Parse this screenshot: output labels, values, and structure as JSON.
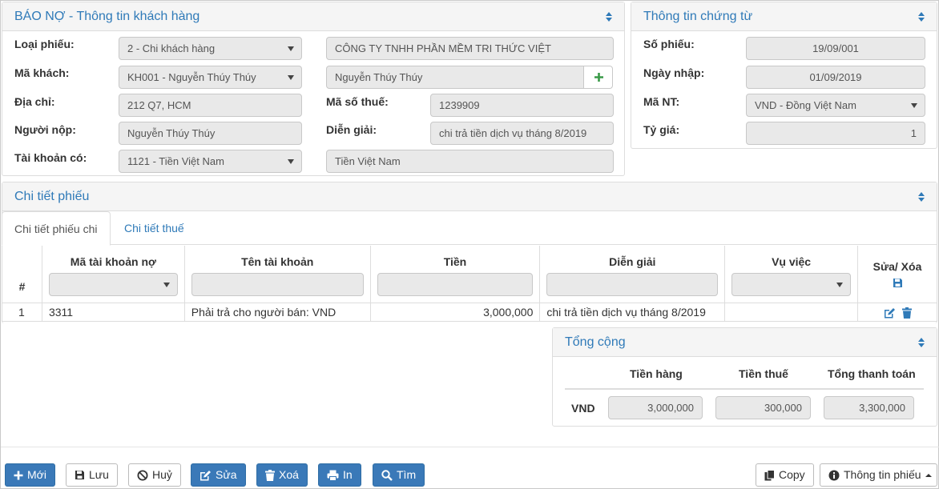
{
  "customer_panel": {
    "title": "BÁO NỢ - Thông tin khách hàng",
    "labels": {
      "voucher_type": "Loại phiếu:",
      "customer_code": "Mã khách:",
      "address": "Địa chỉ:",
      "payer": "Người nộp:",
      "credit_account": "Tài khoản có:",
      "tax_code": "Mã số thuế:",
      "description": "Diễn giải:"
    },
    "values": {
      "voucher_type": "2 - Chi khách hàng",
      "company": "CÔNG TY TNHH PHẦN MỀM TRI THỨC VIỆT",
      "customer_code": "KH001 - Nguyễn Thúy Thúy",
      "customer_name": "Nguyễn Thúy Thúy",
      "address": "212 Q7, HCM",
      "tax_code": "1239909",
      "payer": "Nguyễn Thúy Thúy",
      "description": "chi trả tiền dịch vụ tháng 8/2019",
      "credit_account": "1121 - Tiền Việt Nam",
      "credit_account_name": "Tiền Việt Nam"
    }
  },
  "document_panel": {
    "title": "Thông tin chứng từ",
    "labels": {
      "voucher_no": "Số phiếu:",
      "entry_date": "Ngày nhập:",
      "currency": "Mã NT:",
      "exchange_rate": "Tỷ giá:"
    },
    "values": {
      "voucher_no": "19/09/001",
      "entry_date": "01/09/2019",
      "currency": "VND - Đồng Việt Nam",
      "exchange_rate": "1"
    }
  },
  "detail_panel": {
    "title": "Chi tiết phiếu",
    "tabs": [
      "Chi tiết phiếu chi",
      "Chi tiết thuế"
    ],
    "columns": {
      "index": "#",
      "debit_account": "Mã tài khoản nợ",
      "account_name": "Tên tài khoản",
      "amount": "Tiền",
      "description": "Diễn giải",
      "case": "Vụ việc",
      "actions": "Sửa/ Xóa"
    },
    "rows": [
      {
        "index": "1",
        "debit_account": "3311",
        "account_name": "Phải trả cho người bán: VND",
        "amount": "3,000,000",
        "description": "chi trả tiền dịch vụ tháng 8/2019",
        "case": ""
      }
    ]
  },
  "totals_panel": {
    "title": "Tổng cộng",
    "headers": {
      "goods": "Tiền hàng",
      "tax": "Tiền thuế",
      "total": "Tổng thanh toán"
    },
    "currency": "VND",
    "values": {
      "goods": "3,000,000",
      "tax": "300,000",
      "total": "3,300,000"
    }
  },
  "toolbar": {
    "new": "Mới",
    "save": "Lưu",
    "cancel": "Huỷ",
    "edit": "Sửa",
    "delete": "Xoá",
    "print": "In",
    "search": "Tìm",
    "copy": "Copy",
    "info": "Thông tin phiếu"
  },
  "colors": {
    "primary": "#3a79b8",
    "title_blue": "#2f7ab8",
    "plus_green": "#3a9a48"
  }
}
